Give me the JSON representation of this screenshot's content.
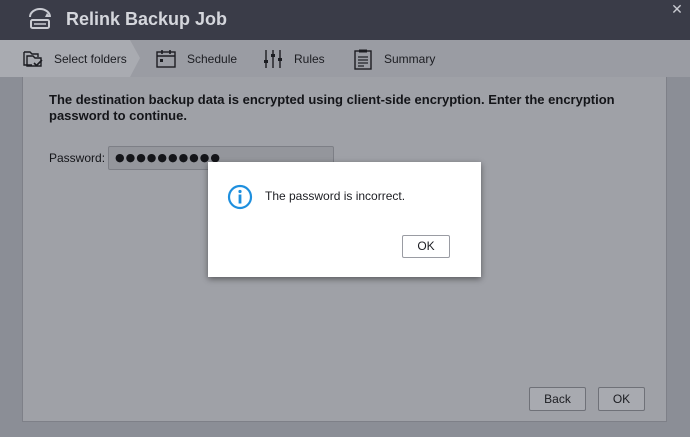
{
  "window": {
    "title": "Relink Backup Job",
    "close_symbol": "✕"
  },
  "steps": [
    {
      "label": "Select folders",
      "icon": "folders-icon",
      "active": true
    },
    {
      "label": "Schedule",
      "icon": "calendar-icon",
      "active": false
    },
    {
      "label": "Rules",
      "icon": "sliders-icon",
      "active": false
    },
    {
      "label": "Summary",
      "icon": "clipboard-icon",
      "active": false
    }
  ],
  "main": {
    "notice": "The destination backup data is encrypted using client-side encryption. Enter the encryption password to continue.",
    "password_label": "Password:",
    "password_value": "●●●●●●●●●●"
  },
  "footer": {
    "back_label": "Back",
    "ok_label": "OK"
  },
  "dialog": {
    "message": "The password is incorrect.",
    "ok_label": "OK",
    "icon": "info-icon"
  },
  "colors": {
    "titlebar": "#3a3c48",
    "info_blue": "#1e8fde"
  }
}
